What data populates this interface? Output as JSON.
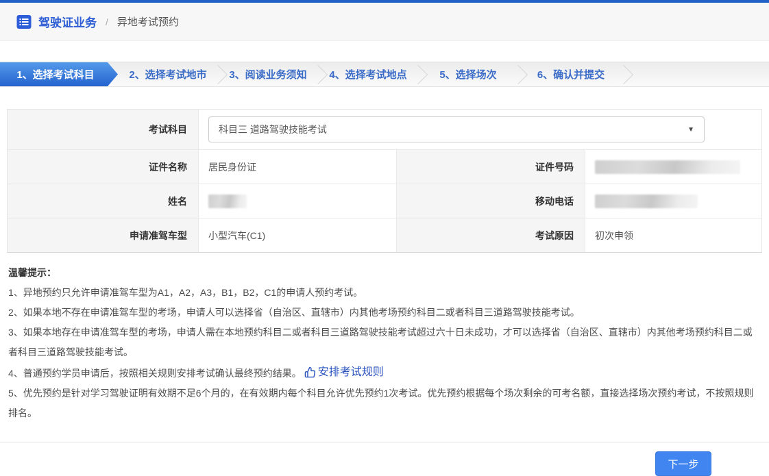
{
  "breadcrumb": {
    "icon": "list-icon",
    "section_label": "驾驶证业务",
    "separator": "/",
    "current_page": "异地考试预约"
  },
  "steps": [
    {
      "label": "1、选择考试科目",
      "active": true
    },
    {
      "label": "2、选择考试地市",
      "active": false
    },
    {
      "label": "3、阅读业务须知",
      "active": false
    },
    {
      "label": "4、选择考试地点",
      "active": false
    },
    {
      "label": "5、选择场次",
      "active": false
    },
    {
      "label": "6、确认并提交",
      "active": false
    }
  ],
  "form": {
    "subject": {
      "label": "考试科目",
      "value": "科目三 道路驾驶技能考试"
    },
    "rows": [
      {
        "left_label": "证件名称",
        "left_value": "居民身份证",
        "right_label": "证件号码",
        "right_value": "",
        "right_redacted": true
      },
      {
        "left_label": "姓名",
        "left_value": "",
        "left_redacted": true,
        "right_label": "移动电话",
        "right_value": "",
        "right_redacted": true
      },
      {
        "left_label": "申请准驾车型",
        "left_value": "小型汽车(C1)",
        "right_label": "考试原因",
        "right_value": "初次申领"
      }
    ]
  },
  "tips": {
    "title": "温馨提示：",
    "item1": "1、异地预约只允许申请准驾车型为A1，A2，A3，B1，B2，C1的申请人预约考试。",
    "item2": "2、如果本地不存在申请准驾车型的考场，申请人可以选择省（自治区、直辖市）内其他考场预约科目二或者科目三道路驾驶技能考试。",
    "item3": "3、如果本地存在申请准驾车型的考场，申请人需在本地预约科目二或者科目三道路驾驶技能考试超过六十日未成功，才可以选择省（自治区、直辖市）内其他考场预约科目二或者科目三道路驾驶技能考试。",
    "item4_prefix": "4、普通预约学员申请后，按照相关规则安排考试确认最终预约结果。",
    "item4_link": "安排考试规则",
    "item5": "5、优先预约是针对学习驾驶证明有效期不足6个月的，在有效期内每个科目允许优先预约1次考试。优先预约根据每个场次剩余的可考名额，直接选择场次预约考试，不按照规则排名。"
  },
  "footer": {
    "next_button_label": "下一步"
  },
  "colors": {
    "top_bar_blue": "#2161c8",
    "accent_blue": "#3a6cc8",
    "active_step_gradient_top": "#549ae9",
    "active_step_gradient_bottom": "#2463cf",
    "button_blue": "#4186f0",
    "link_blue": "#2a52c0",
    "label_cell_bg": "#f5f5f5"
  }
}
